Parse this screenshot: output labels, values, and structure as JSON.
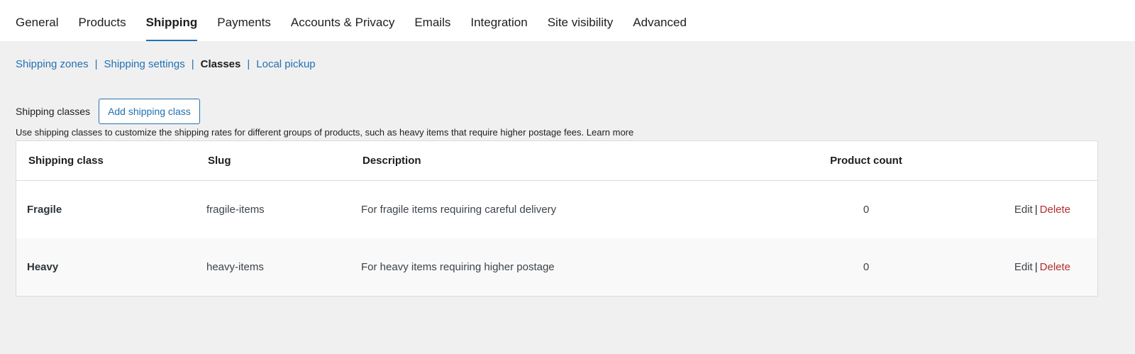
{
  "tabs": [
    {
      "label": "General"
    },
    {
      "label": "Products"
    },
    {
      "label": "Shipping"
    },
    {
      "label": "Payments"
    },
    {
      "label": "Accounts & Privacy"
    },
    {
      "label": "Emails"
    },
    {
      "label": "Integration"
    },
    {
      "label": "Site visibility"
    },
    {
      "label": "Advanced"
    }
  ],
  "active_tab": "Shipping",
  "subnav": {
    "zones": "Shipping zones",
    "settings": "Shipping settings",
    "classes": "Classes",
    "pickup": "Local pickup",
    "separator": "|"
  },
  "section": {
    "label": "Shipping classes",
    "add_button": "Add shipping class",
    "help_text": "Use shipping classes to customize the shipping rates for different groups of products, such as heavy items that require higher postage fees.",
    "learn_more": "Learn more"
  },
  "table": {
    "headers": {
      "name": "Shipping class",
      "slug": "Slug",
      "description": "Description",
      "count": "Product count"
    },
    "rows": [
      {
        "name": "Fragile",
        "slug": "fragile-items",
        "description": "For fragile items requiring careful delivery",
        "count": "0",
        "edit": "Edit",
        "sep": "|",
        "delete": "Delete"
      },
      {
        "name": "Heavy",
        "slug": "heavy-items",
        "description": "For heavy items requiring higher postage",
        "count": "0",
        "edit": "Edit",
        "sep": "|",
        "delete": "Delete"
      }
    ]
  },
  "colors": {
    "accent": "#2271b1",
    "delete": "#b32d2e",
    "background": "#f0f0f1"
  }
}
